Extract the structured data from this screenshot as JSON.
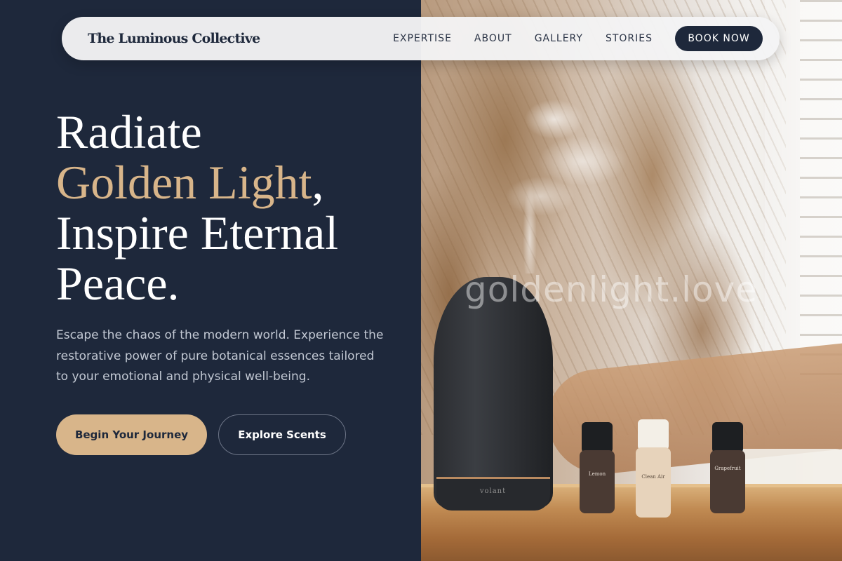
{
  "nav": {
    "brand": "The Luminous Collective",
    "links": [
      "EXPERTISE",
      "ABOUT",
      "GALLERY",
      "STORIES"
    ],
    "cta": "BOOK NOW"
  },
  "hero": {
    "line1": "Radiate",
    "line2_highlight": "Golden Light",
    "line2_punct": ",",
    "line3": "Inspire Eternal",
    "line4": "Peace.",
    "subtext": "Escape the chaos of the modern world. Experience the restorative power of pure botanical essences tailored to your emotional and physical well-being.",
    "primary_button": "Begin Your Journey",
    "secondary_button": "Explore Scents"
  },
  "photo": {
    "watermark": "goldenlight.love",
    "diffuser_logo": "volant",
    "bottles": [
      "Lemon",
      "Clean Air",
      "Grapefruit"
    ]
  },
  "colors": {
    "navy": "#1e283b",
    "gold": "#d8b58a",
    "nav_bg": "#f4f4f5"
  }
}
